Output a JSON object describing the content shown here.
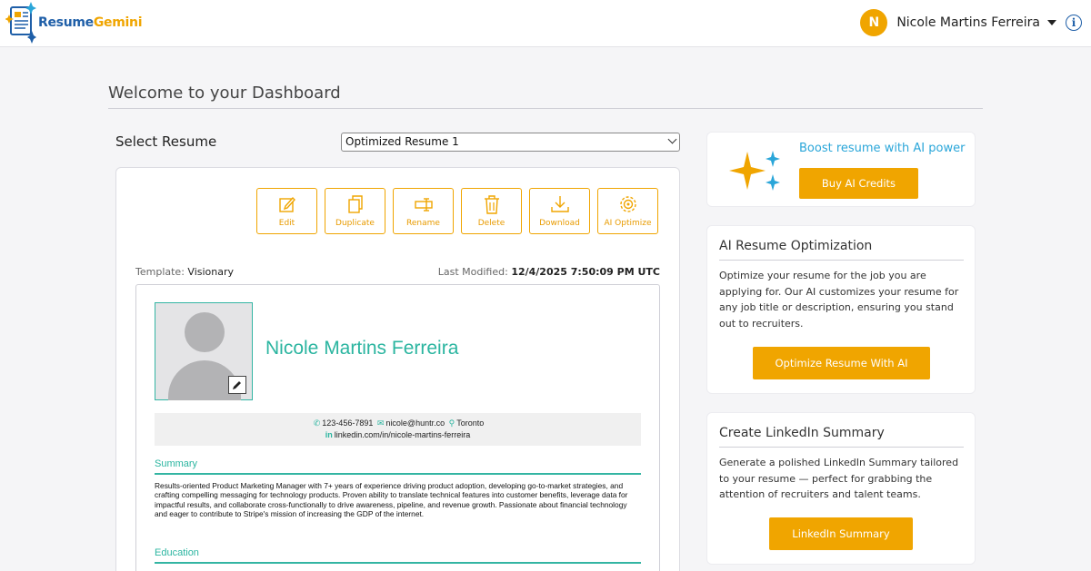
{
  "header": {
    "brand_part1": "Resume",
    "brand_part2": "Gemini",
    "user_initial": "N",
    "user_name": "Nicole Martins Ferreira"
  },
  "dashboard": {
    "title": "Welcome to your Dashboard",
    "select_label": "Select Resume",
    "selected_resume": "Optimized Resume 1"
  },
  "actions": [
    {
      "label": "Edit",
      "icon": "edit-icon"
    },
    {
      "label": "Duplicate",
      "icon": "duplicate-icon"
    },
    {
      "label": "Rename",
      "icon": "rename-icon"
    },
    {
      "label": "Delete",
      "icon": "trash-icon"
    },
    {
      "label": "Download",
      "icon": "download-icon"
    },
    {
      "label": "AI Optimize",
      "icon": "ai-optimize-icon"
    }
  ],
  "meta": {
    "template_label": "Template:",
    "template_value": "Visionary",
    "modified_label": "Last Modified:",
    "modified_value": "12/4/2025 7:50:09 PM UTC"
  },
  "resume": {
    "name": "Nicole Martins Ferreira",
    "phone": "123-456-7891",
    "email": "nicole@huntr.co",
    "location": "Toronto",
    "linkedin": "linkedin.com/in/nicole-martins-ferreira",
    "summary_title": "Summary",
    "summary_text": "Results-oriented Product Marketing Manager with 7+ years of experience driving product adoption, developing go-to-market strategies, and crafting compelling messaging for technology products. Proven ability to translate technical features into customer benefits, leverage data for impactful results, and collaborate cross-functionally to drive awareness, pipeline, and revenue growth. Passionate about financial technology and eager to contribute to Stripe's mission of increasing the GDP of the internet.",
    "education_title": "Education"
  },
  "boost": {
    "title": "Boost resume with AI power",
    "button": "Buy AI Credits"
  },
  "ai_optimization": {
    "title": "AI Resume Optimization",
    "text": "Optimize your resume for the job you are applying for. Our AI customizes your resume for any job title or description, ensuring you stand out to recruiters.",
    "button": "Optimize Resume With AI"
  },
  "linkedin_summary": {
    "title": "Create LinkedIn Summary",
    "text": "Generate a polished LinkedIn Summary tailored to your resume — perfect for grabbing the attention of recruiters and talent teams.",
    "button": "LinkedIn Summary"
  },
  "colors": {
    "accent": "#f0a500",
    "brand_blue": "#1f5fa8",
    "teal": "#2bb5a0",
    "sky": "#2aa6d9"
  }
}
